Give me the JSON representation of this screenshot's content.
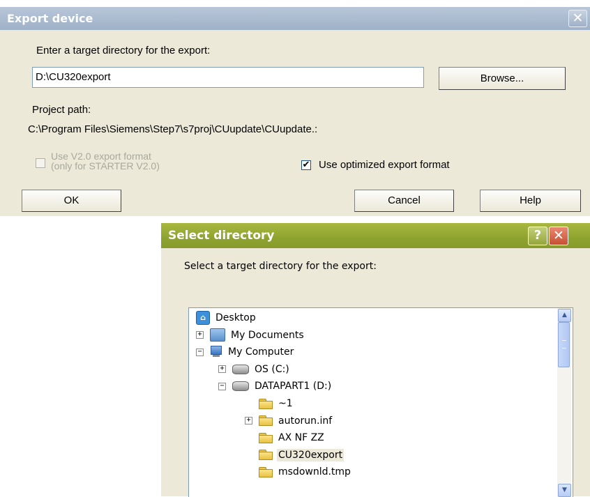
{
  "export_dialog": {
    "title": "Export device",
    "close_glyph": "✕",
    "target_label": "Enter a target directory for the export:",
    "target_value": "D:\\CU320export",
    "browse_label": "Browse...",
    "project_path_label": "Project path:",
    "project_path_value": "C:\\Program Files\\Siemens\\Step7\\s7proj\\CUupdate\\CUupdate.:",
    "v20_label_line1": "Use V2.0 export format",
    "v20_label_line2": "(only for STARTER V2.0)",
    "v20_checked": false,
    "optimized_label": "Use optimized export format",
    "optimized_checked": true,
    "ok_label": "OK",
    "cancel_label": "Cancel",
    "help_label": "Help"
  },
  "select_dialog": {
    "title": "Select directory",
    "help_glyph": "?",
    "close_glyph": "✕",
    "label": "Select a target directory for the export:",
    "tree": [
      {
        "label": "Desktop",
        "icon": "desktop-icon",
        "expander": "none",
        "selected": false
      },
      {
        "label": "My Documents",
        "icon": "my-documents-icon",
        "expander": "plus",
        "selected": false
      },
      {
        "label": "My Computer",
        "icon": "my-computer-icon",
        "expander": "minus",
        "selected": false
      },
      {
        "label": "OS (C:)",
        "icon": "drive-icon",
        "expander": "plus",
        "selected": false
      },
      {
        "label": "DATAPART1 (D:)",
        "icon": "drive-icon",
        "expander": "minus",
        "selected": false
      },
      {
        "label": "~1",
        "icon": "folder-icon",
        "expander": "none",
        "selected": false
      },
      {
        "label": "autorun.inf",
        "icon": "folder-icon",
        "expander": "plus",
        "selected": false
      },
      {
        "label": "AX NF ZZ",
        "icon": "folder-icon",
        "expander": "none",
        "selected": false
      },
      {
        "label": "CU320export",
        "icon": "folder-icon",
        "expander": "none",
        "selected": true
      },
      {
        "label": "msdownld.tmp",
        "icon": "folder-icon",
        "expander": "none",
        "selected": false
      }
    ]
  }
}
